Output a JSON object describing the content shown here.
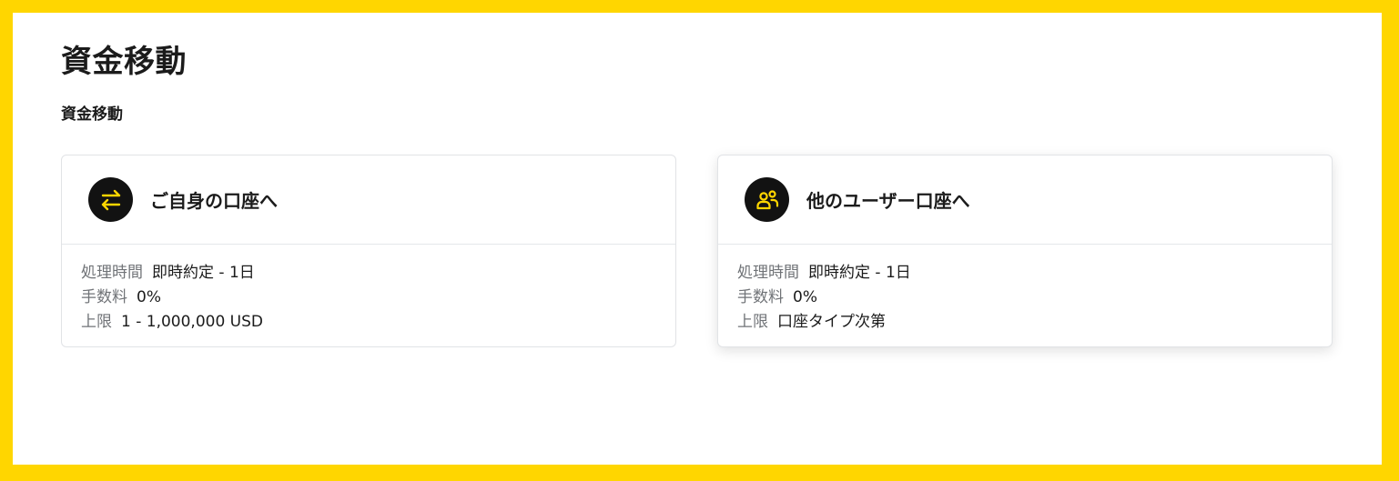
{
  "page": {
    "title": "資金移動",
    "section_title": "資金移動"
  },
  "cards": [
    {
      "icon": "swap-arrows-icon",
      "title": "ご自身の口座へ",
      "rows": [
        {
          "label": "処理時間",
          "value": "即時約定 - 1日"
        },
        {
          "label": "手数料",
          "value": "0%"
        },
        {
          "label": "上限",
          "value": "1 - 1,000,000 USD"
        }
      ]
    },
    {
      "icon": "users-icon",
      "title": "他のユーザー口座へ",
      "rows": [
        {
          "label": "処理時間",
          "value": "即時約定 - 1日"
        },
        {
          "label": "手数料",
          "value": "0%"
        },
        {
          "label": "上限",
          "value": "口座タイプ次第"
        }
      ]
    }
  ],
  "colors": {
    "accent": "#ffd600",
    "icon_bg": "#121212",
    "muted_text": "#707377"
  }
}
